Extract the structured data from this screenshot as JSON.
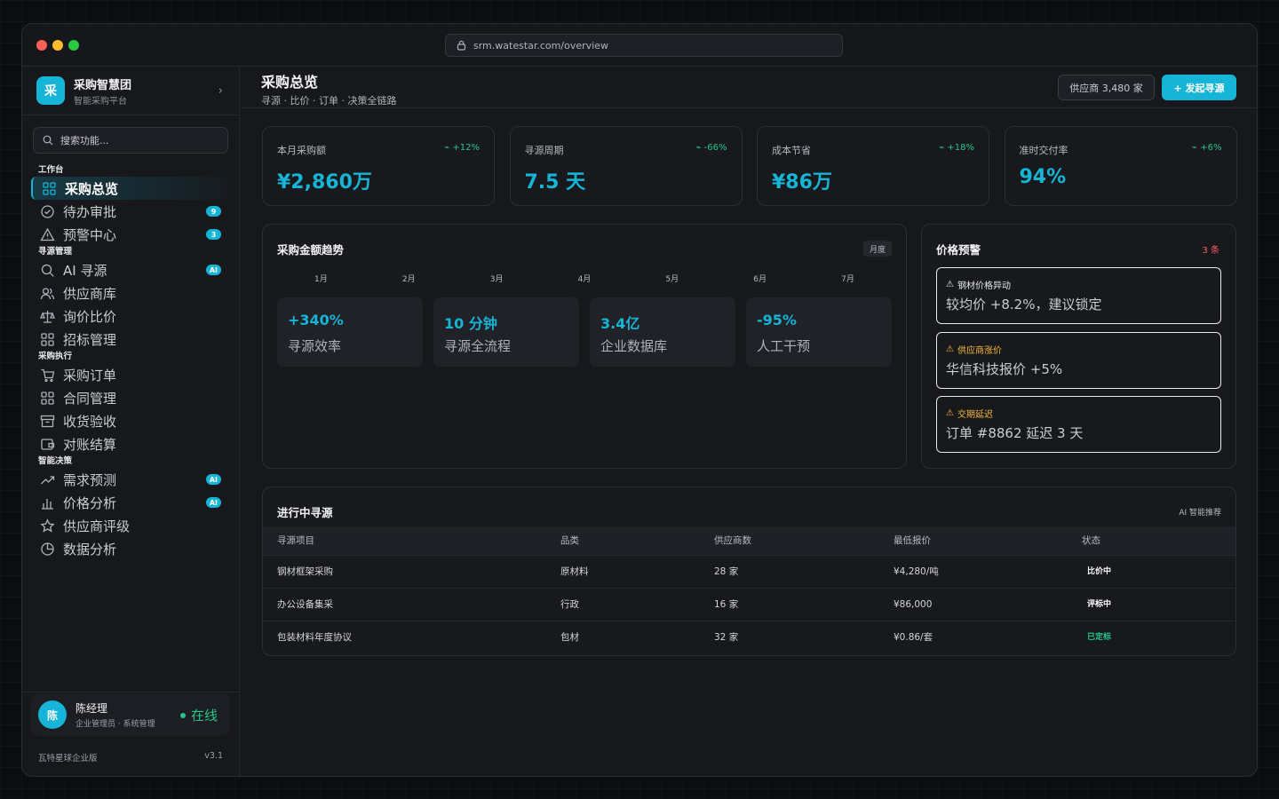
{
  "browser": {
    "url": "srm.watestar.com/overview"
  },
  "brand": {
    "logo": "采",
    "name": "采购智慧团",
    "sub": "智能采购平台"
  },
  "search": {
    "placeholder": "搜索功能..."
  },
  "sidebar": {
    "sections": [
      {
        "title": "工作台",
        "items": [
          {
            "label": "采购总览",
            "icon": "grid-icon",
            "active": true
          },
          {
            "label": "待办审批",
            "icon": "check-circle-icon",
            "badge": "9"
          },
          {
            "label": "预警中心",
            "icon": "warning-icon",
            "badge": "3"
          }
        ]
      },
      {
        "title": "寻源管理",
        "items": [
          {
            "label": "AI 寻源",
            "icon": "search-icon",
            "badge": "AI"
          },
          {
            "label": "供应商库",
            "icon": "users-icon"
          },
          {
            "label": "询价比价",
            "icon": "scale-icon"
          },
          {
            "label": "招标管理",
            "icon": "grid-icon"
          }
        ]
      },
      {
        "title": "采购执行",
        "items": [
          {
            "label": "采购订单",
            "icon": "cart-icon"
          },
          {
            "label": "合同管理",
            "icon": "grid-icon"
          },
          {
            "label": "收货验收",
            "icon": "archive-icon"
          },
          {
            "label": "对账结算",
            "icon": "wallet-icon"
          }
        ]
      },
      {
        "title": "智能决策",
        "items": [
          {
            "label": "需求预测",
            "icon": "trend-icon",
            "badge": "AI"
          },
          {
            "label": "价格分析",
            "icon": "bar-chart-icon",
            "badge": "AI"
          },
          {
            "label": "供应商评级",
            "icon": "star-icon"
          },
          {
            "label": "数据分析",
            "icon": "pie-icon"
          }
        ]
      }
    ]
  },
  "user": {
    "avatar": "陈",
    "name": "陈经理",
    "role": "企业管理员 · 系统管理",
    "status": "在线"
  },
  "footer": {
    "edition": "瓦特星球企业版",
    "version": "v3.1"
  },
  "header": {
    "title": "采购总览",
    "subtitle": "寻源 · 比价 · 订单 · 决策全链路",
    "supplier_btn": "供应商 3,480 家",
    "start_btn": "+ 发起寻源"
  },
  "kpis": [
    {
      "label": "本月采购额",
      "delta": "+12%",
      "value": "¥2,860万"
    },
    {
      "label": "寻源周期",
      "delta": "-66%",
      "value": "7.5 天"
    },
    {
      "label": "成本节省",
      "delta": "+18%",
      "value": "¥86万"
    },
    {
      "label": "准时交付率",
      "delta": "+6%",
      "value": "94%"
    }
  ],
  "trend": {
    "title": "采购金额趋势",
    "tag": "月度",
    "months": [
      "1月",
      "2月",
      "3月",
      "4月",
      "5月",
      "6月",
      "7月"
    ],
    "stats": [
      {
        "value": "+340%",
        "label": "寻源效率"
      },
      {
        "value": "10 分钟",
        "label": "寻源全流程"
      },
      {
        "value": "3.4亿",
        "label": "企业数据库"
      },
      {
        "value": "-95%",
        "label": "人工干预"
      }
    ]
  },
  "alerts": {
    "title": "价格预警",
    "count": "3 条",
    "items": [
      {
        "title": "钢材价格异动",
        "body": "较均价 +8.2%，建议锁定",
        "color": "#e6e8ec"
      },
      {
        "title": "供应商涨价",
        "body": "华信科技报价 +5%",
        "color": "#f5b83d"
      },
      {
        "title": "交期延迟",
        "body": "订单 #8862 延迟 3 天",
        "color": "#f5b83d"
      }
    ]
  },
  "sourcing": {
    "title": "进行中寻源",
    "tag": "AI 智能推荐",
    "columns": [
      "寻源项目",
      "品类",
      "供应商数",
      "最低报价",
      "状态"
    ],
    "rows": [
      {
        "project": "钢材框架采购",
        "category": "原材料",
        "suppliers": "28 家",
        "price": "¥4,280/吨",
        "status": "比价中",
        "status_color": "#ffffff"
      },
      {
        "project": "办公设备集采",
        "category": "行政",
        "suppliers": "16 家",
        "price": "¥86,000",
        "status": "评标中",
        "status_color": "#ffffff"
      },
      {
        "project": "包装材料年度协议",
        "category": "包材",
        "suppliers": "32 家",
        "price": "¥0.86/套",
        "status": "已定标",
        "status_color": "#25c58a"
      }
    ]
  },
  "colors": {
    "accent": "#16b4d6",
    "positive": "#25c58a",
    "danger": "#ff5b6b",
    "warning": "#f5b83d"
  }
}
